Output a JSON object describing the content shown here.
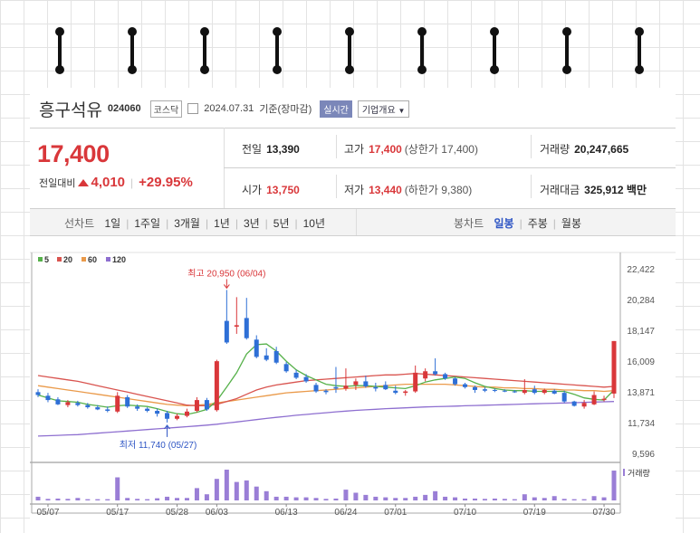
{
  "stock": {
    "name": "흥구석유",
    "code": "024060",
    "market": "코스닥",
    "base_date": "2024.07.31",
    "base_note": "기준(장마감)",
    "live_label": "실시간",
    "company_info_label": "기업개요"
  },
  "quote": {
    "price": "17,400",
    "change_label": "전일대비",
    "change": "4,010",
    "change_pct": "+29.95%",
    "prev_close_label": "전일",
    "prev_close": "13,390",
    "high_label": "고가",
    "high": "17,400",
    "upper_limit_label": "상한가",
    "upper_limit": "17,400",
    "volume_label": "거래량",
    "volume": "20,247,665",
    "open_label": "시가",
    "open": "13,750",
    "low_label": "저가",
    "low": "13,440",
    "lower_limit_label": "하한가",
    "lower_limit": "9,380",
    "amount_label": "거래대금",
    "amount": "325,912",
    "amount_unit": "백만"
  },
  "tabs": {
    "line_chart_label": "선차트",
    "line_periods": [
      "1일",
      "1주일",
      "3개월",
      "1년",
      "3년",
      "5년",
      "10년"
    ],
    "candle_chart_label": "봉차트",
    "candle_periods": [
      "일봉",
      "주봉",
      "월봉"
    ],
    "active_candle": "일봉"
  },
  "colors": {
    "up": "#d9373a",
    "down": "#2e6fd6",
    "ma5": "#56b14a",
    "ma20": "#d9544f",
    "ma60": "#ea9a4a",
    "ma120": "#8e6fd0",
    "volume": "#9a7ed6"
  },
  "chart_data": {
    "type": "candlestick",
    "legend": [
      {
        "name": "5",
        "color": "#56b14a"
      },
      {
        "name": "20",
        "color": "#d9544f"
      },
      {
        "name": "60",
        "color": "#ea9a4a"
      },
      {
        "name": "120",
        "color": "#8e6fd0"
      }
    ],
    "y_ticks": [
      "22,422",
      "20,284",
      "18,147",
      "16,009",
      "13,871",
      "11,734",
      "9,596"
    ],
    "ylim": [
      9596,
      22422
    ],
    "x_ticks": [
      {
        "label": "05/07",
        "index": 1
      },
      {
        "label": "05/17",
        "index": 8
      },
      {
        "label": "05/28",
        "index": 14
      },
      {
        "label": "06/03",
        "index": 18
      },
      {
        "label": "06/13",
        "index": 25
      },
      {
        "label": "06/24",
        "index": 31
      },
      {
        "label": "07/01",
        "index": 36
      },
      {
        "label": "07/10",
        "index": 43
      },
      {
        "label": "07/19",
        "index": 50
      },
      {
        "label": "07/30",
        "index": 57
      }
    ],
    "annotations": {
      "max_text": "최고 20,950 (06/04)",
      "max_index": 19,
      "max_value": 20950,
      "min_text": "최저 11,740 (05/27)",
      "min_index": 13,
      "min_value": 11740
    },
    "volume_label": "거래량",
    "candles": [
      {
        "o": 13850,
        "h": 14050,
        "l": 13500,
        "c": 13650
      },
      {
        "o": 13600,
        "h": 13800,
        "l": 13150,
        "c": 13300
      },
      {
        "o": 13350,
        "h": 13500,
        "l": 12950,
        "c": 13000
      },
      {
        "o": 12950,
        "h": 13300,
        "l": 12800,
        "c": 13150
      },
      {
        "o": 13100,
        "h": 13250,
        "l": 12850,
        "c": 12950
      },
      {
        "o": 12950,
        "h": 13100,
        "l": 12700,
        "c": 12800
      },
      {
        "o": 12800,
        "h": 12950,
        "l": 12600,
        "c": 12650
      },
      {
        "o": 12650,
        "h": 12850,
        "l": 12450,
        "c": 12550
      },
      {
        "o": 12500,
        "h": 13850,
        "l": 12400,
        "c": 13600
      },
      {
        "o": 13500,
        "h": 13650,
        "l": 12750,
        "c": 12850
      },
      {
        "o": 12850,
        "h": 13000,
        "l": 12550,
        "c": 12700
      },
      {
        "o": 12700,
        "h": 12800,
        "l": 12450,
        "c": 12550
      },
      {
        "o": 12550,
        "h": 12700,
        "l": 12150,
        "c": 12350
      },
      {
        "o": 12400,
        "h": 12550,
        "l": 11740,
        "c": 12000
      },
      {
        "o": 12000,
        "h": 12350,
        "l": 11900,
        "c": 12200
      },
      {
        "o": 12200,
        "h": 12700,
        "l": 12100,
        "c": 12500
      },
      {
        "o": 12550,
        "h": 13500,
        "l": 12450,
        "c": 13300
      },
      {
        "o": 13300,
        "h": 13450,
        "l": 12550,
        "c": 12650
      },
      {
        "o": 12600,
        "h": 16100,
        "l": 12500,
        "c": 16000
      },
      {
        "o": 18800,
        "h": 20950,
        "l": 17200,
        "c": 17300
      },
      {
        "o": 18400,
        "h": 20450,
        "l": 17900,
        "c": 18500
      },
      {
        "o": 19000,
        "h": 20400,
        "l": 17500,
        "c": 17600
      },
      {
        "o": 17500,
        "h": 17800,
        "l": 16200,
        "c": 16300
      },
      {
        "o": 16400,
        "h": 16900,
        "l": 16000,
        "c": 16100
      },
      {
        "o": 16700,
        "h": 17000,
        "l": 15800,
        "c": 15900
      },
      {
        "o": 15800,
        "h": 15950,
        "l": 15200,
        "c": 15300
      },
      {
        "o": 15200,
        "h": 15400,
        "l": 14750,
        "c": 14850
      },
      {
        "o": 14900,
        "h": 15100,
        "l": 14500,
        "c": 14600
      },
      {
        "o": 14350,
        "h": 14500,
        "l": 13800,
        "c": 13900
      },
      {
        "o": 13950,
        "h": 14050,
        "l": 13700,
        "c": 13850
      },
      {
        "o": 14200,
        "h": 15600,
        "l": 13800,
        "c": 14100
      },
      {
        "o": 14100,
        "h": 15500,
        "l": 13950,
        "c": 14300
      },
      {
        "o": 14350,
        "h": 14800,
        "l": 14000,
        "c": 14600
      },
      {
        "o": 14600,
        "h": 15000,
        "l": 14150,
        "c": 14250
      },
      {
        "o": 14200,
        "h": 14500,
        "l": 13900,
        "c": 14100
      },
      {
        "o": 14350,
        "h": 14600,
        "l": 14000,
        "c": 14050
      },
      {
        "o": 13950,
        "h": 14300,
        "l": 13700,
        "c": 13800
      },
      {
        "o": 13800,
        "h": 14000,
        "l": 13600,
        "c": 13900
      },
      {
        "o": 13900,
        "h": 15700,
        "l": 13800,
        "c": 15200
      },
      {
        "o": 14800,
        "h": 15500,
        "l": 14600,
        "c": 15300
      },
      {
        "o": 15300,
        "h": 16200,
        "l": 15000,
        "c": 15100
      },
      {
        "o": 15100,
        "h": 15200,
        "l": 14700,
        "c": 14800
      },
      {
        "o": 14800,
        "h": 14900,
        "l": 14300,
        "c": 14400
      },
      {
        "o": 14400,
        "h": 14500,
        "l": 14100,
        "c": 14200
      },
      {
        "o": 14200,
        "h": 14300,
        "l": 13800,
        "c": 14000
      },
      {
        "o": 14050,
        "h": 14200,
        "l": 13850,
        "c": 13950
      },
      {
        "o": 14000,
        "h": 14100,
        "l": 13850,
        "c": 13950
      },
      {
        "o": 13950,
        "h": 14050,
        "l": 13850,
        "c": 13900
      },
      {
        "o": 13900,
        "h": 14000,
        "l": 13800,
        "c": 13850
      },
      {
        "o": 13800,
        "h": 14750,
        "l": 13700,
        "c": 14000
      },
      {
        "o": 14050,
        "h": 14300,
        "l": 13700,
        "c": 13800
      },
      {
        "o": 13800,
        "h": 14100,
        "l": 13700,
        "c": 14000
      },
      {
        "o": 13950,
        "h": 14050,
        "l": 13700,
        "c": 13750
      },
      {
        "o": 13800,
        "h": 13950,
        "l": 13100,
        "c": 13200
      },
      {
        "o": 13200,
        "h": 13250,
        "l": 12850,
        "c": 12900
      },
      {
        "o": 12850,
        "h": 13300,
        "l": 12700,
        "c": 13100
      },
      {
        "o": 13000,
        "h": 13900,
        "l": 12950,
        "c": 13650
      },
      {
        "o": 13300,
        "h": 13600,
        "l": 13200,
        "c": 13390
      },
      {
        "o": 13750,
        "h": 17400,
        "l": 13440,
        "c": 17400
      }
    ],
    "volume": [
      0.12,
      0.05,
      0.06,
      0.05,
      0.08,
      0.04,
      0.04,
      0.04,
      0.75,
      0.08,
      0.05,
      0.04,
      0.07,
      0.12,
      0.08,
      0.08,
      0.4,
      0.2,
      0.7,
      1.0,
      0.6,
      0.65,
      0.45,
      0.3,
      0.12,
      0.12,
      0.1,
      0.1,
      0.08,
      0.05,
      0.06,
      0.35,
      0.25,
      0.18,
      0.12,
      0.1,
      0.08,
      0.08,
      0.12,
      0.18,
      0.3,
      0.12,
      0.1,
      0.06,
      0.06,
      0.05,
      0.06,
      0.05,
      0.04,
      0.2,
      0.1,
      0.08,
      0.14,
      0.05,
      0.04,
      0.04,
      0.14,
      0.1,
      0.97
    ],
    "ma5": [
      13650,
      13450,
      13250,
      13200,
      13150,
      13000,
      12900,
      12800,
      12900,
      12950,
      12900,
      12850,
      12700,
      12500,
      12350,
      12300,
      12450,
      12650,
      13250,
      14200,
      15200,
      16500,
      17150,
      17200,
      16700,
      16000,
      15400,
      15000,
      14700,
      14400,
      14300,
      14250,
      14300,
      14300,
      14250,
      14200,
      14150,
      14100,
      14300,
      14550,
      14700,
      14800,
      14900,
      14800,
      14500,
      14250,
      14100,
      14000,
      13950,
      13950,
      13900,
      13900,
      13900,
      13900,
      13700,
      13450,
      13350,
      13300,
      14000
    ],
    "ma20": [
      15000,
      14900,
      14800,
      14700,
      14600,
      14450,
      14300,
      14150,
      14000,
      13850,
      13700,
      13550,
      13400,
      13250,
      13100,
      12950,
      12900,
      12900,
      13000,
      13200,
      13400,
      13700,
      14000,
      14200,
      14350,
      14450,
      14550,
      14650,
      14700,
      14750,
      14800,
      14850,
      14900,
      14950,
      15000,
      15050,
      15050,
      15100,
      15150,
      15100,
      15050,
      15000,
      14950,
      14900,
      14850,
      14800,
      14750,
      14700,
      14650,
      14600,
      14550,
      14500,
      14450,
      14400,
      14350,
      14300,
      14250,
      14200,
      14250
    ],
    "ma60": [
      14300,
      14200,
      14100,
      14000,
      13900,
      13800,
      13700,
      13600,
      13500,
      13400,
      13300,
      13200,
      13100,
      13000,
      12950,
      12900,
      12950,
      13000,
      13100,
      13200,
      13300,
      13400,
      13500,
      13600,
      13700,
      13800,
      13850,
      13900,
      13950,
      14000,
      14050,
      14100,
      14150,
      14200,
      14250,
      14300,
      14350,
      14400,
      14400,
      14400,
      14400,
      14400,
      14350,
      14300,
      14250,
      14200,
      14200,
      14150,
      14150,
      14100,
      14100,
      14050,
      14050,
      14000,
      14000,
      13950,
      13950,
      13900,
      13950
    ],
    "ma120": [
      10800,
      10820,
      10850,
      10880,
      10900,
      10950,
      11000,
      11050,
      11100,
      11150,
      11200,
      11250,
      11300,
      11350,
      11400,
      11450,
      11500,
      11560,
      11620,
      11700,
      11780,
      11860,
      11940,
      12020,
      12100,
      12170,
      12240,
      12300,
      12360,
      12420,
      12480,
      12530,
      12580,
      12620,
      12660,
      12700,
      12730,
      12760,
      12790,
      12820,
      12840,
      12860,
      12880,
      12900,
      12920,
      12940,
      12960,
      12980,
      13000,
      13020,
      13040,
      13060,
      13080,
      13100,
      13120,
      13140,
      13160,
      13180,
      13200
    ]
  }
}
